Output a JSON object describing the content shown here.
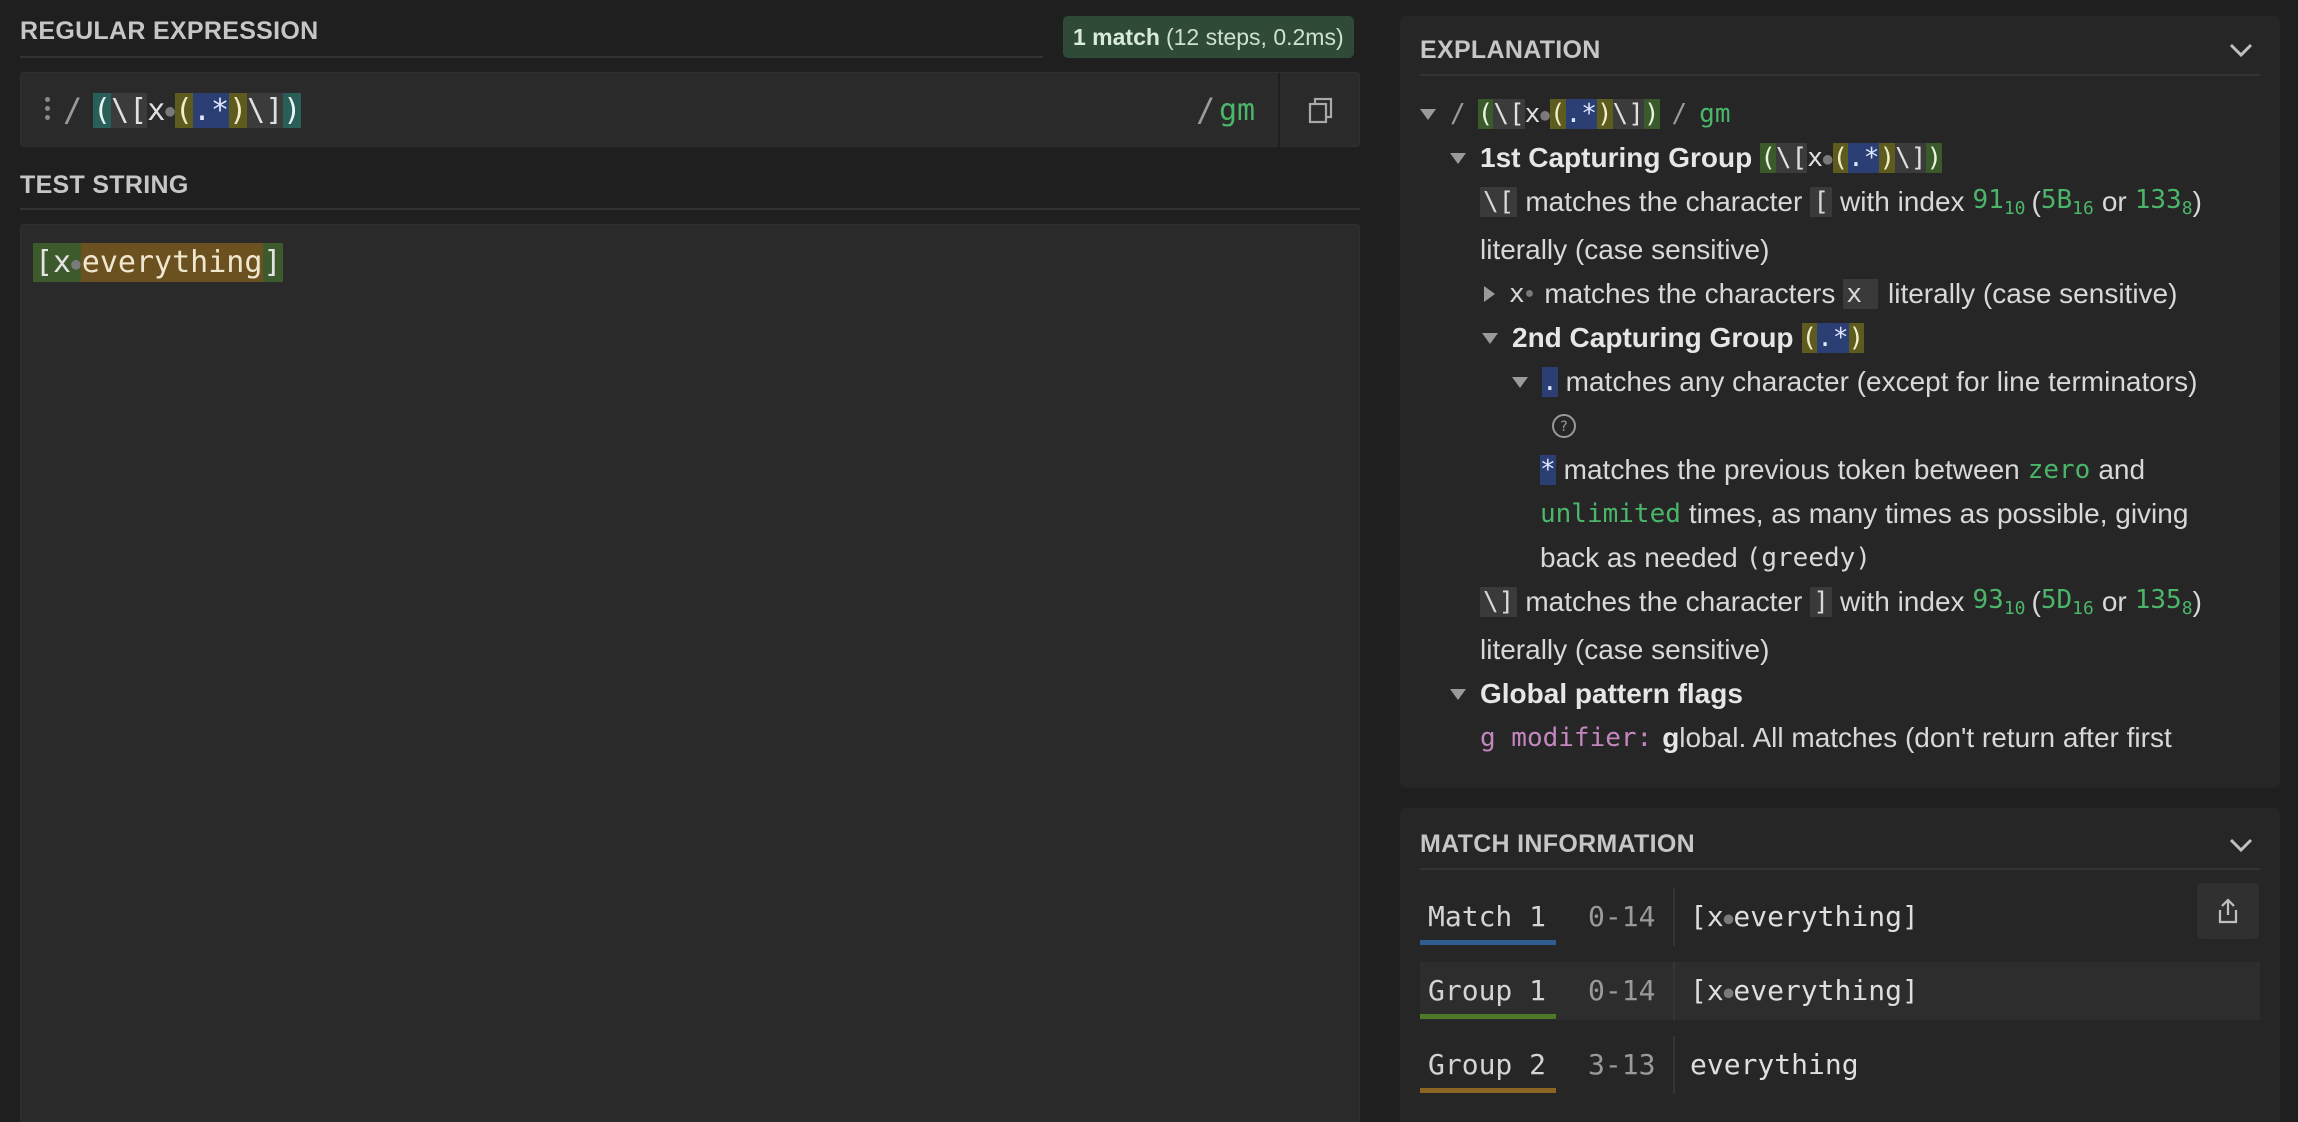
{
  "regex_section": {
    "title": "REGULAR EXPRESSION",
    "match_badge": {
      "bold": "1 match",
      "detail": "(12 steps, 0.2ms)"
    },
    "open_delim": "/",
    "close_delim": "/",
    "flags": "gm",
    "tokens": {
      "open_paren": "(",
      "esc_open": "\\[",
      "x": "x",
      "inner_open": "(",
      "dot": ".",
      "star": "*",
      "inner_close": ")",
      "esc_close": "\\]",
      "close_paren": ")"
    }
  },
  "test_section": {
    "title": "TEST STRING",
    "text_prefix": "[x",
    "text_match": "everything",
    "text_suffix": "]"
  },
  "explanation": {
    "title": "EXPLANATION",
    "root_open": "/",
    "root_close": "/",
    "root_flags": "gm",
    "group1_label": "1st Capturing Group",
    "esc_open_token": "\\[",
    "esc_open_desc_a": "matches the character",
    "esc_open_char": "[",
    "esc_open_desc_b": "with index",
    "esc_open_dec": "91",
    "esc_open_dec_base": "10",
    "esc_open_hex": "5B",
    "esc_open_hex_base": "16",
    "or1": "or",
    "esc_open_oct": "133",
    "esc_open_oct_base": "8",
    "literally1": "literally (case sensitive)",
    "x_token": "x",
    "x_desc_a": "matches the characters",
    "x_char": "x",
    "x_desc_b": "literally (case sensitive)",
    "group2_label": "2nd Capturing Group",
    "dot_token": ".",
    "dot_desc": "matches any character (except for line terminators)",
    "star_token": "*",
    "star_desc_a": "matches the previous token between",
    "zero": "zero",
    "and": "and",
    "unlimited": "unlimited",
    "star_desc_b": "times, as many times as possible, giving",
    "star_desc_c": "back as needed",
    "greedy": "(greedy)",
    "esc_close_token": "\\]",
    "esc_close_desc_a": "matches the character",
    "esc_close_char": "]",
    "esc_close_desc_b": "with index",
    "esc_close_dec": "93",
    "esc_close_dec_base": "10",
    "esc_close_hex": "5D",
    "esc_close_hex_base": "16",
    "or2": "or",
    "esc_close_oct": "135",
    "esc_close_oct_base": "8",
    "literally2": "literally (case sensitive)",
    "flags_label": "Global pattern flags",
    "g_modifier": "g modifier:",
    "g_desc_bold": "g",
    "g_desc": "lobal. All matches (don't return after first"
  },
  "match_info": {
    "title": "MATCH INFORMATION",
    "rows": [
      {
        "label": "Match 1",
        "range": "0-14",
        "value_a": "[x",
        "value_b": "everything]",
        "color": "#2f5d8f"
      },
      {
        "label": "Group 1",
        "range": "0-14",
        "value_a": "[x",
        "value_b": "everything]",
        "color": "#4c7a27"
      },
      {
        "label": "Group 2",
        "range": "3-13",
        "value_a": "everything",
        "value_b": "",
        "color": "#8a6420"
      }
    ]
  }
}
